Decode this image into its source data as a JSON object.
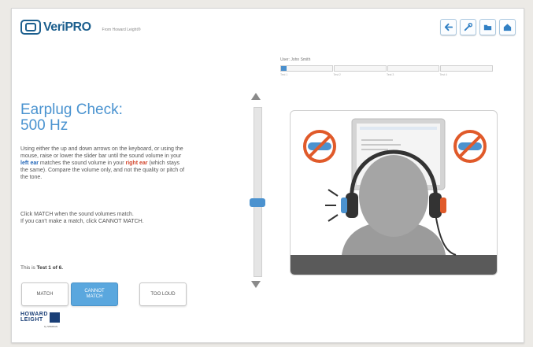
{
  "header": {
    "logo_text": "VeriPRO",
    "logo_subtitle": "From Howard Leight®"
  },
  "toolbar": {
    "back_icon": "arrow-left-icon",
    "tools_icon": "wrench-icon",
    "folder_icon": "folder-icon",
    "home_icon": "home-icon"
  },
  "user": {
    "label": "User: John Smith"
  },
  "progress": {
    "steps": [
      "Test 1",
      "Test 2",
      "Test 3",
      "Test 4"
    ],
    "current_fraction": 0.03
  },
  "content": {
    "title_line1": "Earplug Check:",
    "title_line2": "500 Hz",
    "instr_part1": "Using either the up and down arrows on the keyboard, or using the mouse, raise or lower the slider bar until the sound volume in your ",
    "instr_left_ear": "left ear",
    "instr_part2": " matches the sound volume in your ",
    "instr_right_ear": "right ear",
    "instr_part3": " (which stays the same). Compare the volume only, and not the quality or pitch of the tone.",
    "match_note_line1": "Click MATCH when the sound volumes match.",
    "match_note_line2": "If you can't make a match, click CANNOT MATCH.",
    "test_count_prefix": "This is ",
    "test_count_value": "Test 1 of 6."
  },
  "buttons": {
    "match": "MATCH",
    "cannot_line1": "CANNOT",
    "cannot_line2": "MATCH",
    "too_loud": "TOO LOUD"
  },
  "footer": {
    "brand_line1": "HOWARD",
    "brand_line2": "LEIGHT",
    "brand_sub": "by SPERIAN"
  },
  "colors": {
    "accent": "#4a93d0",
    "slider_thumb": "#4b92cf",
    "highlight_left": "#2266b8",
    "highlight_right": "#d2452b"
  }
}
